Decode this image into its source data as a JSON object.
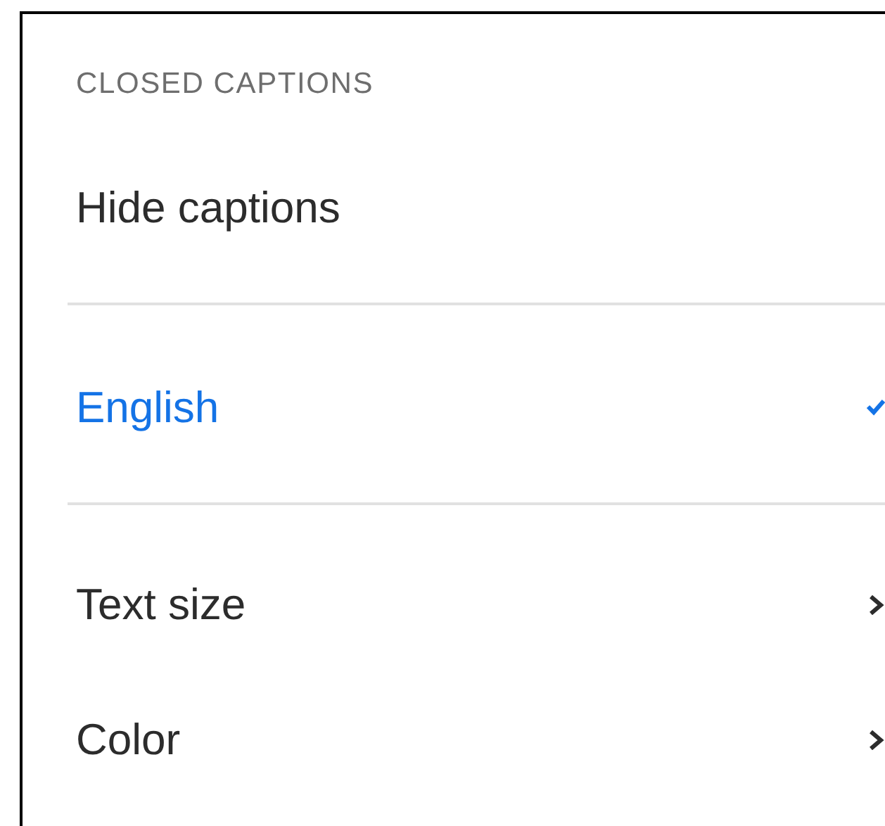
{
  "panel": {
    "heading": "CLOSED CAPTIONS",
    "sections": [
      {
        "items": [
          {
            "kind": "action",
            "label": "Hide captions"
          }
        ]
      },
      {
        "items": [
          {
            "kind": "option",
            "label": "English",
            "selected": true
          }
        ]
      },
      {
        "items": [
          {
            "kind": "submenu",
            "label": "Text size"
          },
          {
            "kind": "submenu",
            "label": "Color"
          }
        ]
      }
    ]
  }
}
